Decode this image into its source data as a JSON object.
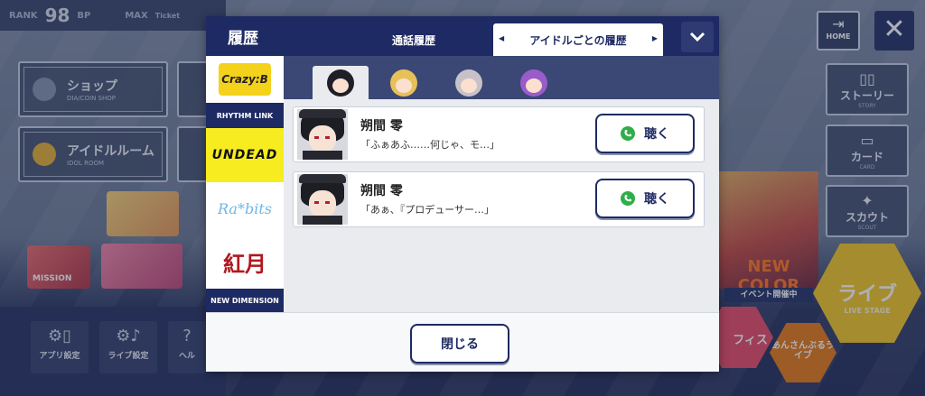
{
  "topbar": {
    "rank_label": "RANK",
    "rank_value": "98",
    "bp_label": "BP",
    "max_label": "MAX",
    "ticket_label": "Ticket"
  },
  "background_menu": {
    "shop": {
      "label": "ショップ",
      "sub": "DIA/COIN SHOP"
    },
    "idol_room": {
      "label": "アイドルルーム",
      "sub": "IDOL ROOM"
    },
    "mission_label": "MISSION"
  },
  "right_menu": {
    "home": "HOME",
    "story": {
      "label": "ストーリー",
      "sub": "STORY"
    },
    "card": {
      "label": "カード",
      "sub": "CARD"
    },
    "scout": {
      "label": "スカウト",
      "sub": "SCOUT"
    },
    "live": {
      "label": "ライブ",
      "sub": "LIVE STAGE"
    },
    "office": "フィス",
    "ensemble": "あんさんぶるライブ",
    "event_title": "NEW COLOR",
    "event_tag": "イベント開催中"
  },
  "bottom_menu": {
    "app_settings": "アプリ設定",
    "live_settings": "ライブ設定",
    "help": "ヘル"
  },
  "modal": {
    "title": "履歴",
    "tabs": {
      "call_history": "通話履歴",
      "idol_history": "アイドルごとの履歴"
    },
    "units": {
      "crazyb": "Crazy:B",
      "rhythm_link": "RHYTHM LINK",
      "undead": "UNDEAD",
      "rabits": "Ra*bits",
      "akatsuki": "紅月",
      "new_dimension": "NEW DIMENSION"
    },
    "entries": [
      {
        "name": "朔間 零",
        "line": "「ふぁあふ……何じゃ、モ…」",
        "button": "聴く"
      },
      {
        "name": "朔間 零",
        "line": "「あぁ、『プロデューサー…」",
        "button": "聴く"
      }
    ],
    "close": "閉じる"
  },
  "colors": {
    "navy": "#1e2a63",
    "undead_yellow": "#f6ec1f",
    "phone_green": "#2fae4a"
  }
}
